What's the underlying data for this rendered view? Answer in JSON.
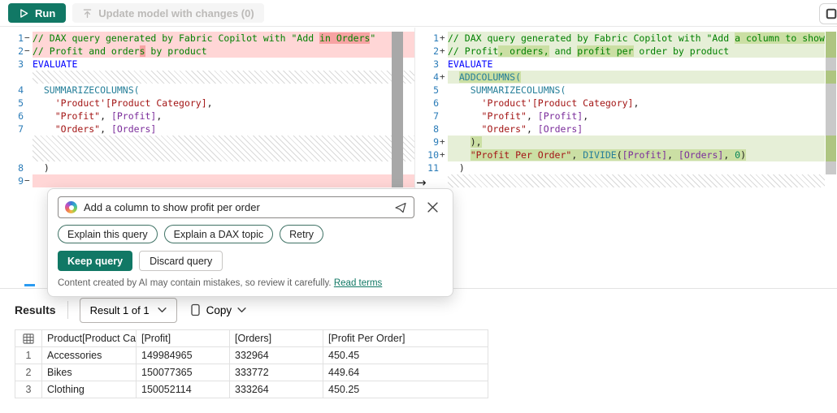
{
  "toolbar": {
    "run_label": "Run",
    "update_label": "Update model with changes (0)"
  },
  "editor": {
    "arrow_glyph": "→",
    "left_pane": {
      "lines": [
        {
          "n": "1",
          "mk": "−",
          "t": "removed",
          "seg": [
            [
              "// DAX query generated by Fabric Copilot with \"Add ",
              "c",
              0
            ],
            [
              "in Orders",
              "c",
              1
            ],
            [
              "\"",
              "c",
              0
            ]
          ]
        },
        {
          "n": "2",
          "mk": "−",
          "t": "removed",
          "seg": [
            [
              "// Profit and order",
              "c",
              0
            ],
            [
              "s",
              "c",
              1
            ],
            [
              " by product",
              "c",
              0
            ]
          ]
        },
        {
          "n": "3",
          "mk": "",
          "t": "normal",
          "seg": [
            [
              "EVALUATE",
              "k",
              0
            ]
          ]
        },
        {
          "t": "filler",
          "h": 1
        },
        {
          "n": "4",
          "mk": "",
          "t": "normal",
          "seg": [
            [
              "  ",
              "d",
              0
            ],
            [
              "SUMMARIZECOLUMNS(",
              "f",
              0
            ]
          ]
        },
        {
          "n": "5",
          "mk": "",
          "t": "normal",
          "seg": [
            [
              "    ",
              "d",
              0
            ],
            [
              "'Product'[Product Category]",
              "col",
              0
            ],
            [
              ",",
              "d",
              0
            ]
          ]
        },
        {
          "n": "6",
          "mk": "",
          "t": "normal",
          "seg": [
            [
              "    ",
              "d",
              0
            ],
            [
              "\"Profit\"",
              "s",
              0
            ],
            [
              ", ",
              "d",
              0
            ],
            [
              "[Profit]",
              "m",
              0
            ],
            [
              ",",
              "d",
              0
            ]
          ]
        },
        {
          "n": "7",
          "mk": "",
          "t": "normal",
          "seg": [
            [
              "    ",
              "d",
              0
            ],
            [
              "\"Orders\"",
              "s",
              0
            ],
            [
              ", ",
              "d",
              0
            ],
            [
              "[Orders]",
              "m",
              0
            ]
          ]
        },
        {
          "t": "filler",
          "h": 2
        },
        {
          "n": "8",
          "mk": "",
          "t": "normal",
          "seg": [
            [
              "  )",
              "d",
              0
            ]
          ]
        },
        {
          "n": "9",
          "mk": "−",
          "t": "removed",
          "seg": []
        }
      ]
    },
    "right_pane": {
      "lines": [
        {
          "n": "1",
          "mk": "+",
          "t": "added",
          "seg": [
            [
              "// DAX query generated by Fabric Copilot with \"Add ",
              "c",
              0
            ],
            [
              "a column to show profit per order",
              "c",
              1
            ],
            [
              "\"",
              "c",
              0
            ]
          ]
        },
        {
          "n": "2",
          "mk": "+",
          "t": "added",
          "seg": [
            [
              "// Profit",
              "c",
              0
            ],
            [
              ", orders,",
              "c",
              1
            ],
            [
              " and ",
              "c",
              0
            ],
            [
              "profit per",
              "c",
              1
            ],
            [
              " order by product",
              "c",
              0
            ]
          ]
        },
        {
          "n": "3",
          "mk": "",
          "t": "normal",
          "seg": [
            [
              "EVALUATE",
              "k",
              0
            ]
          ]
        },
        {
          "n": "4",
          "mk": "+",
          "t": "added",
          "seg": [
            [
              "  ",
              "d",
              0
            ],
            [
              "ADDCOLUMNS(",
              "f",
              1
            ]
          ]
        },
        {
          "n": "5",
          "mk": "",
          "t": "normal",
          "seg": [
            [
              "    ",
              "d",
              0
            ],
            [
              "SUMMARIZECOLUMNS(",
              "f",
              0
            ]
          ]
        },
        {
          "n": "6",
          "mk": "",
          "t": "normal",
          "seg": [
            [
              "      ",
              "d",
              0
            ],
            [
              "'Product'[Product Category]",
              "col",
              0
            ],
            [
              ",",
              "d",
              0
            ]
          ]
        },
        {
          "n": "7",
          "mk": "",
          "t": "normal",
          "seg": [
            [
              "      ",
              "d",
              0
            ],
            [
              "\"Profit\"",
              "s",
              0
            ],
            [
              ", ",
              "d",
              0
            ],
            [
              "[Profit]",
              "m",
              0
            ],
            [
              ",",
              "d",
              0
            ]
          ]
        },
        {
          "n": "8",
          "mk": "",
          "t": "normal",
          "seg": [
            [
              "      ",
              "d",
              0
            ],
            [
              "\"Orders\"",
              "s",
              0
            ],
            [
              ", ",
              "d",
              0
            ],
            [
              "[Orders]",
              "m",
              0
            ]
          ]
        },
        {
          "n": "9",
          "mk": "+",
          "t": "added",
          "seg": [
            [
              "    ",
              "d",
              0
            ],
            [
              "),",
              "d",
              1
            ]
          ]
        },
        {
          "n": "10",
          "mk": "+",
          "t": "added",
          "seg": [
            [
              "    ",
              "d",
              0
            ],
            [
              "\"Profit Per Order\"",
              "s",
              1
            ],
            [
              ", ",
              "d",
              1
            ],
            [
              "DIVIDE",
              "f",
              1
            ],
            [
              "(",
              "d",
              1
            ],
            [
              "[Profit]",
              "m",
              1
            ],
            [
              ", ",
              "d",
              1
            ],
            [
              "[Orders]",
              "m",
              1
            ],
            [
              ", ",
              "d",
              1
            ],
            [
              "0",
              "n",
              1
            ],
            [
              ")",
              "d",
              1
            ]
          ]
        },
        {
          "n": "11",
          "mk": "",
          "t": "normal",
          "seg": [
            [
              "  )",
              "d",
              0
            ]
          ]
        },
        {
          "t": "filler",
          "h": 1
        }
      ]
    }
  },
  "copilot": {
    "prompt": "Add a column to show profit per order",
    "suggestions": [
      "Explain this query",
      "Explain a DAX topic",
      "Retry"
    ],
    "keep_label": "Keep query",
    "discard_label": "Discard query",
    "disclaimer": "Content created by AI may contain mistakes, so review it carefully.",
    "read_terms": "Read terms"
  },
  "results": {
    "title": "Results",
    "selector_label": "Result 1 of 1",
    "copy_label": "Copy",
    "table": {
      "headers": [
        "Product[Product Catego...",
        "[Profit]",
        "[Orders]",
        "[Profit Per Order]"
      ],
      "rows": [
        {
          "num": "1",
          "cells": [
            "Accessories",
            "149984965",
            "332964",
            "450.45"
          ]
        },
        {
          "num": "2",
          "cells": [
            "Bikes",
            "150077365",
            "333772",
            "449.64"
          ]
        },
        {
          "num": "3",
          "cells": [
            "Clothing",
            "150052114",
            "333264",
            "450.25"
          ]
        }
      ]
    }
  },
  "colors": {
    "accent": "#117865",
    "removed_line": "#ffd6d6",
    "removed_char": "#f7a3a3",
    "added_line": "#e6efd7",
    "added_char": "#cbdfa4",
    "c_comment": "#008000",
    "c_keyword": "#0000ff",
    "c_function": "#267f99",
    "c_string": "#a31515",
    "c_measure": "#7b2d9b",
    "c_number": "#098658",
    "c_linenum": "#2b7cb8",
    "ruler_added": "#aec581",
    "ruler_base": "#c9c9c9"
  }
}
